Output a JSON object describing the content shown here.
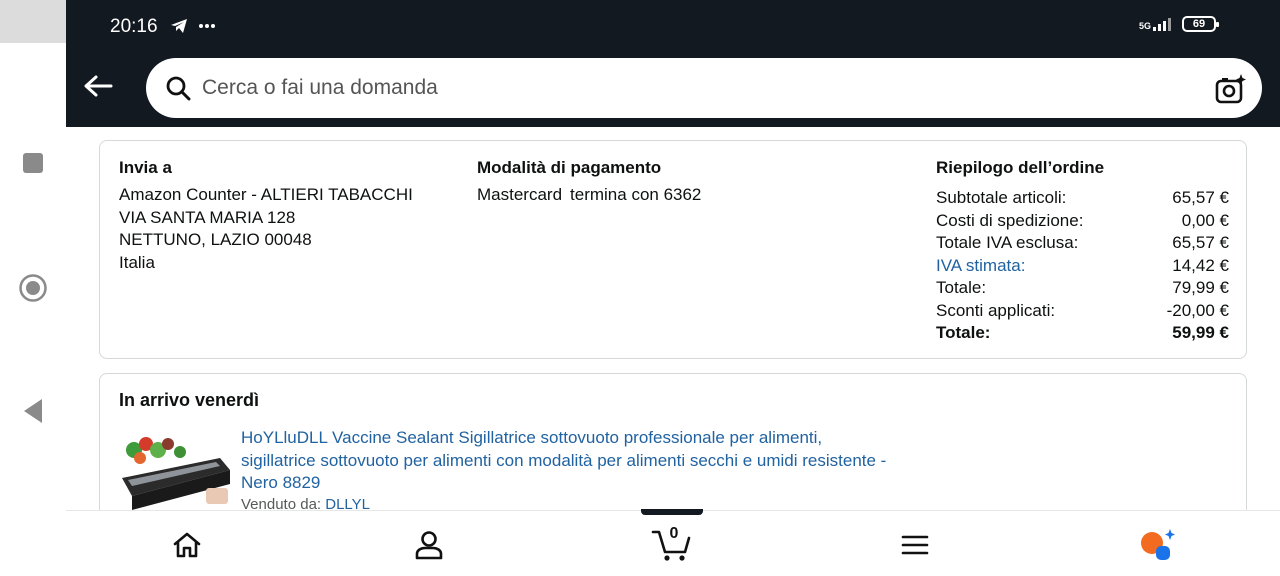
{
  "status_bar": {
    "time": "20:16",
    "network": "5G",
    "battery": "69"
  },
  "search": {
    "placeholder": "Cerca o fai una domanda"
  },
  "shipping": {
    "heading": "Invia a",
    "lines": [
      "Amazon Counter - ALTIERI TABACCHI",
      "VIA SANTA MARIA 128",
      "NETTUNO, LAZIO 00048",
      "Italia"
    ]
  },
  "payment": {
    "heading": "Modalità di pagamento",
    "card_brand": "Mastercard",
    "card_ending": "termina con 6362"
  },
  "summary": {
    "heading": "Riepilogo dell’ordine",
    "rows": [
      {
        "label": "Subtotale articoli:",
        "value": "65,57 €"
      },
      {
        "label": "Costi di spedizione:",
        "value": "0,00 €"
      },
      {
        "label": "Totale IVA esclusa:",
        "value": "65,57 €"
      },
      {
        "label": "IVA stimata:",
        "value": "14,42 €"
      },
      {
        "label": "Totale:",
        "value": "79,99 €"
      },
      {
        "label": "Sconti applicati:",
        "value": "-20,00 €"
      },
      {
        "label": "Totale:",
        "value": "59,99 €"
      }
    ]
  },
  "delivery": {
    "heading": "In arrivo venerdì",
    "product_title": "HoYLluDLL Vaccine Sealant Sigillatrice sottovuoto professionale per alimenti, sigillatrice sottovuoto per alimenti con modalità per alimenti secchi e umidi resistente - Nero 8829",
    "seller_label": "Venduto da:",
    "seller_name": "DLLYL"
  },
  "bottom_nav": {
    "cart_count": "0"
  },
  "colors": {
    "header_bg": "#131921",
    "link": "#2162a1",
    "border": "#d5d9d9"
  }
}
